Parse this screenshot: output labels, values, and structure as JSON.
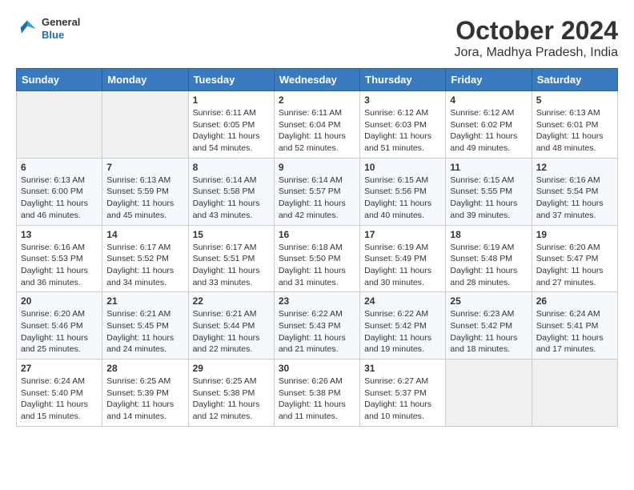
{
  "logo": {
    "general": "General",
    "blue": "Blue"
  },
  "title": "October 2024",
  "subtitle": "Jora, Madhya Pradesh, India",
  "weekdays": [
    "Sunday",
    "Monday",
    "Tuesday",
    "Wednesday",
    "Thursday",
    "Friday",
    "Saturday"
  ],
  "weeks": [
    [
      null,
      null,
      {
        "day": 1,
        "sunrise": "6:11 AM",
        "sunset": "6:05 PM",
        "daylight": "11 hours and 54 minutes."
      },
      {
        "day": 2,
        "sunrise": "6:11 AM",
        "sunset": "6:04 PM",
        "daylight": "11 hours and 52 minutes."
      },
      {
        "day": 3,
        "sunrise": "6:12 AM",
        "sunset": "6:03 PM",
        "daylight": "11 hours and 51 minutes."
      },
      {
        "day": 4,
        "sunrise": "6:12 AM",
        "sunset": "6:02 PM",
        "daylight": "11 hours and 49 minutes."
      },
      {
        "day": 5,
        "sunrise": "6:13 AM",
        "sunset": "6:01 PM",
        "daylight": "11 hours and 48 minutes."
      }
    ],
    [
      {
        "day": 6,
        "sunrise": "6:13 AM",
        "sunset": "6:00 PM",
        "daylight": "11 hours and 46 minutes."
      },
      {
        "day": 7,
        "sunrise": "6:13 AM",
        "sunset": "5:59 PM",
        "daylight": "11 hours and 45 minutes."
      },
      {
        "day": 8,
        "sunrise": "6:14 AM",
        "sunset": "5:58 PM",
        "daylight": "11 hours and 43 minutes."
      },
      {
        "day": 9,
        "sunrise": "6:14 AM",
        "sunset": "5:57 PM",
        "daylight": "11 hours and 42 minutes."
      },
      {
        "day": 10,
        "sunrise": "6:15 AM",
        "sunset": "5:56 PM",
        "daylight": "11 hours and 40 minutes."
      },
      {
        "day": 11,
        "sunrise": "6:15 AM",
        "sunset": "5:55 PM",
        "daylight": "11 hours and 39 minutes."
      },
      {
        "day": 12,
        "sunrise": "6:16 AM",
        "sunset": "5:54 PM",
        "daylight": "11 hours and 37 minutes."
      }
    ],
    [
      {
        "day": 13,
        "sunrise": "6:16 AM",
        "sunset": "5:53 PM",
        "daylight": "11 hours and 36 minutes."
      },
      {
        "day": 14,
        "sunrise": "6:17 AM",
        "sunset": "5:52 PM",
        "daylight": "11 hours and 34 minutes."
      },
      {
        "day": 15,
        "sunrise": "6:17 AM",
        "sunset": "5:51 PM",
        "daylight": "11 hours and 33 minutes."
      },
      {
        "day": 16,
        "sunrise": "6:18 AM",
        "sunset": "5:50 PM",
        "daylight": "11 hours and 31 minutes."
      },
      {
        "day": 17,
        "sunrise": "6:19 AM",
        "sunset": "5:49 PM",
        "daylight": "11 hours and 30 minutes."
      },
      {
        "day": 18,
        "sunrise": "6:19 AM",
        "sunset": "5:48 PM",
        "daylight": "11 hours and 28 minutes."
      },
      {
        "day": 19,
        "sunrise": "6:20 AM",
        "sunset": "5:47 PM",
        "daylight": "11 hours and 27 minutes."
      }
    ],
    [
      {
        "day": 20,
        "sunrise": "6:20 AM",
        "sunset": "5:46 PM",
        "daylight": "11 hours and 25 minutes."
      },
      {
        "day": 21,
        "sunrise": "6:21 AM",
        "sunset": "5:45 PM",
        "daylight": "11 hours and 24 minutes."
      },
      {
        "day": 22,
        "sunrise": "6:21 AM",
        "sunset": "5:44 PM",
        "daylight": "11 hours and 22 minutes."
      },
      {
        "day": 23,
        "sunrise": "6:22 AM",
        "sunset": "5:43 PM",
        "daylight": "11 hours and 21 minutes."
      },
      {
        "day": 24,
        "sunrise": "6:22 AM",
        "sunset": "5:42 PM",
        "daylight": "11 hours and 19 minutes."
      },
      {
        "day": 25,
        "sunrise": "6:23 AM",
        "sunset": "5:42 PM",
        "daylight": "11 hours and 18 minutes."
      },
      {
        "day": 26,
        "sunrise": "6:24 AM",
        "sunset": "5:41 PM",
        "daylight": "11 hours and 17 minutes."
      }
    ],
    [
      {
        "day": 27,
        "sunrise": "6:24 AM",
        "sunset": "5:40 PM",
        "daylight": "11 hours and 15 minutes."
      },
      {
        "day": 28,
        "sunrise": "6:25 AM",
        "sunset": "5:39 PM",
        "daylight": "11 hours and 14 minutes."
      },
      {
        "day": 29,
        "sunrise": "6:25 AM",
        "sunset": "5:38 PM",
        "daylight": "11 hours and 12 minutes."
      },
      {
        "day": 30,
        "sunrise": "6:26 AM",
        "sunset": "5:38 PM",
        "daylight": "11 hours and 11 minutes."
      },
      {
        "day": 31,
        "sunrise": "6:27 AM",
        "sunset": "5:37 PM",
        "daylight": "11 hours and 10 minutes."
      },
      null,
      null
    ]
  ]
}
